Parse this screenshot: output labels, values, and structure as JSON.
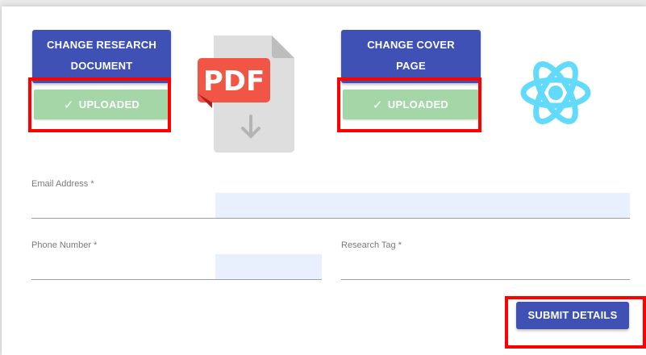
{
  "research": {
    "change_line1": "CHANGE RESEARCH",
    "change_line2": "DOCUMENT",
    "status": "UPLOADED",
    "preview_icon": "pdf-file-icon",
    "preview_text": "PDF"
  },
  "cover": {
    "change_line1": "CHANGE COVER",
    "change_line2": "PAGE",
    "status": "UPLOADED",
    "preview_icon": "react-logo-icon"
  },
  "form": {
    "email_label": "Email Address *",
    "email_value": "",
    "phone_label": "Phone Number *",
    "phone_value": "",
    "tag_label": "Research Tag *",
    "tag_value": ""
  },
  "submit_label": "SUBMIT DETAILS",
  "colors": {
    "primary": "#3f51b5",
    "success": "#a5d6a7",
    "highlight": "#ff0000",
    "pdf_red": "#f05545",
    "react_blue": "#61dafb",
    "autofill": "#e8f0fe"
  }
}
